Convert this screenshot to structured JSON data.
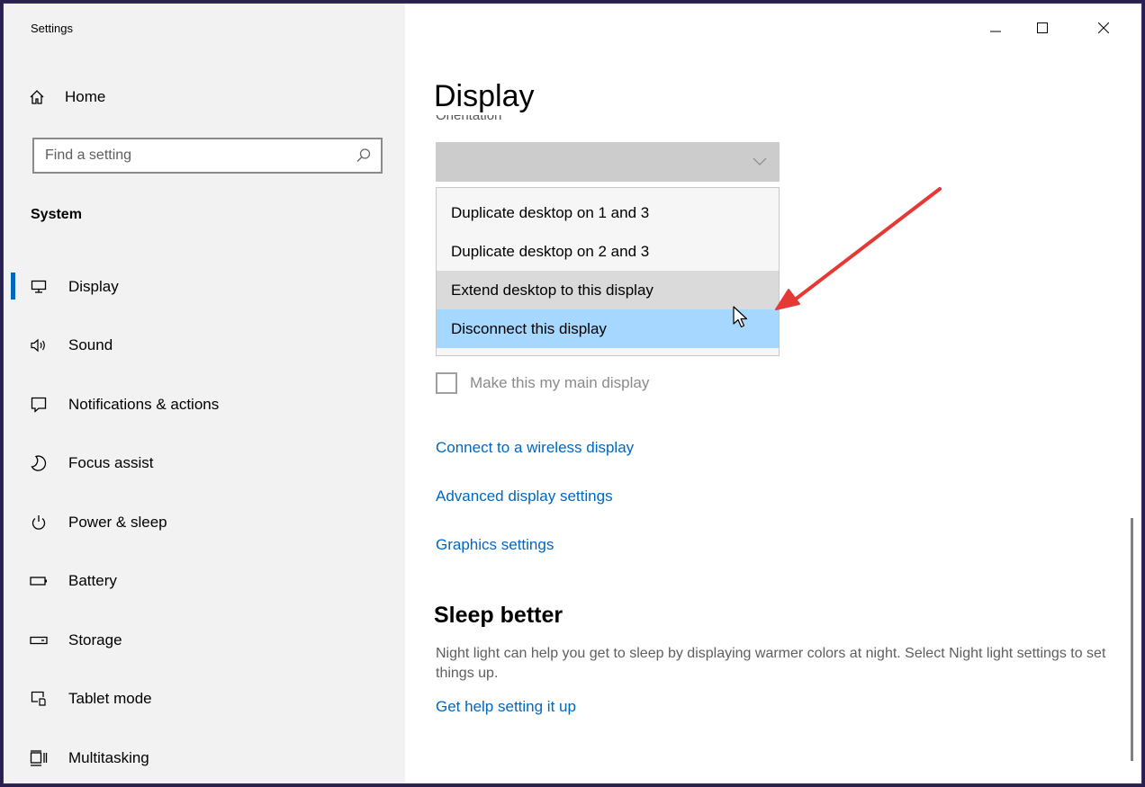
{
  "window": {
    "title": "Settings"
  },
  "sidebar": {
    "home_label": "Home",
    "search_placeholder": "Find a setting",
    "section_title": "System",
    "items": [
      {
        "label": "Display",
        "icon": "monitor-icon",
        "selected": true
      },
      {
        "label": "Sound",
        "icon": "speaker-icon"
      },
      {
        "label": "Notifications & actions",
        "icon": "notification-icon"
      },
      {
        "label": "Focus assist",
        "icon": "moon-icon"
      },
      {
        "label": "Power & sleep",
        "icon": "power-icon"
      },
      {
        "label": "Battery",
        "icon": "battery-icon"
      },
      {
        "label": "Storage",
        "icon": "storage-icon"
      },
      {
        "label": "Tablet mode",
        "icon": "tablet-mode-icon"
      },
      {
        "label": "Multitasking",
        "icon": "multitasking-icon"
      }
    ]
  },
  "main": {
    "page_title": "Display",
    "clipped_label": "Orientation",
    "dropdown_options": [
      {
        "label": "Duplicate desktop on 1 and 3",
        "state": "normal"
      },
      {
        "label": "Duplicate desktop on 2 and 3",
        "state": "normal"
      },
      {
        "label": "Extend desktop to this display",
        "state": "hover"
      },
      {
        "label": "Disconnect this display",
        "state": "selected"
      }
    ],
    "main_display_checkbox": "Make this my main display",
    "links": {
      "wireless": "Connect to a wireless display",
      "advanced": "Advanced display settings",
      "graphics": "Graphics settings"
    },
    "sleep_better": {
      "title": "Sleep better",
      "description": "Night light can help you get to sleep by displaying warmer colors at night. Select Night light settings to set things up.",
      "help_link": "Get help setting it up"
    }
  },
  "colors": {
    "accent": "#0067c0",
    "selection": "#a6d8ff",
    "annotation_arrow": "#e53935"
  }
}
